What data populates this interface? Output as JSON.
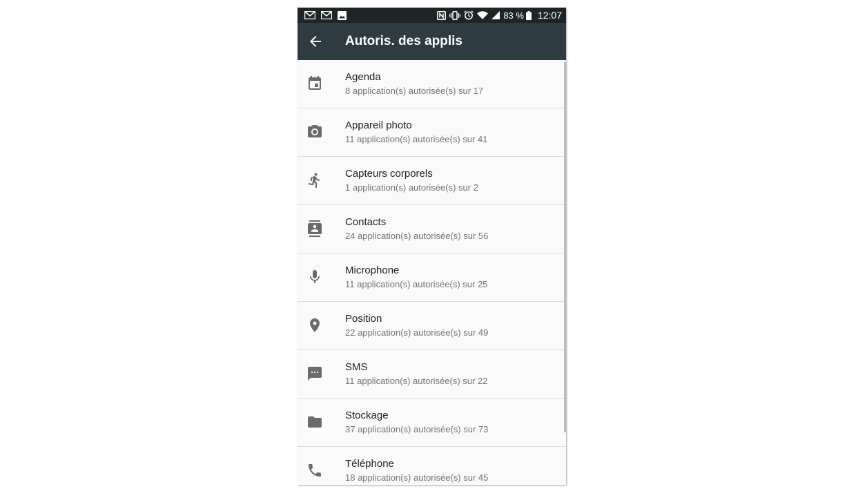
{
  "status_bar": {
    "left_icons": [
      "gmail-icon",
      "gmail-icon",
      "image-icon"
    ],
    "right_icons": [
      "nfc-icon",
      "vibrate-icon",
      "alarm-icon",
      "wifi-icon",
      "signal-icon"
    ],
    "battery": "83 %",
    "time": "12:07"
  },
  "app_bar": {
    "title": "Autoris. des applis",
    "back_icon": "arrow-back-icon"
  },
  "permissions": [
    {
      "icon": "calendar-icon",
      "title": "Agenda",
      "subtitle": "8 application(s) autorisée(s) sur 17"
    },
    {
      "icon": "camera-icon",
      "title": "Appareil photo",
      "subtitle": "11 application(s) autorisée(s) sur 41"
    },
    {
      "icon": "running-icon",
      "title": "Capteurs corporels",
      "subtitle": "1 application(s) autorisée(s) sur 2"
    },
    {
      "icon": "contacts-icon",
      "title": "Contacts",
      "subtitle": "24 application(s) autorisée(s) sur 56"
    },
    {
      "icon": "microphone-icon",
      "title": "Microphone",
      "subtitle": "11 application(s) autorisée(s) sur 25"
    },
    {
      "icon": "location-pin-icon",
      "title": "Position",
      "subtitle": "22 application(s) autorisée(s) sur 49"
    },
    {
      "icon": "sms-icon",
      "title": "SMS",
      "subtitle": "11 application(s) autorisée(s) sur 22"
    },
    {
      "icon": "folder-icon",
      "title": "Stockage",
      "subtitle": "37 application(s) autorisée(s) sur 73"
    },
    {
      "icon": "phone-icon",
      "title": "Téléphone",
      "subtitle": "18 application(s) autorisée(s) sur 45"
    }
  ],
  "colors": {
    "status_bar": "#1f2426",
    "app_bar": "#2e3c42",
    "list_bg": "#fafafa",
    "icon": "#6b6b6b",
    "title_text": "#212121",
    "subtitle_text": "#737373"
  }
}
